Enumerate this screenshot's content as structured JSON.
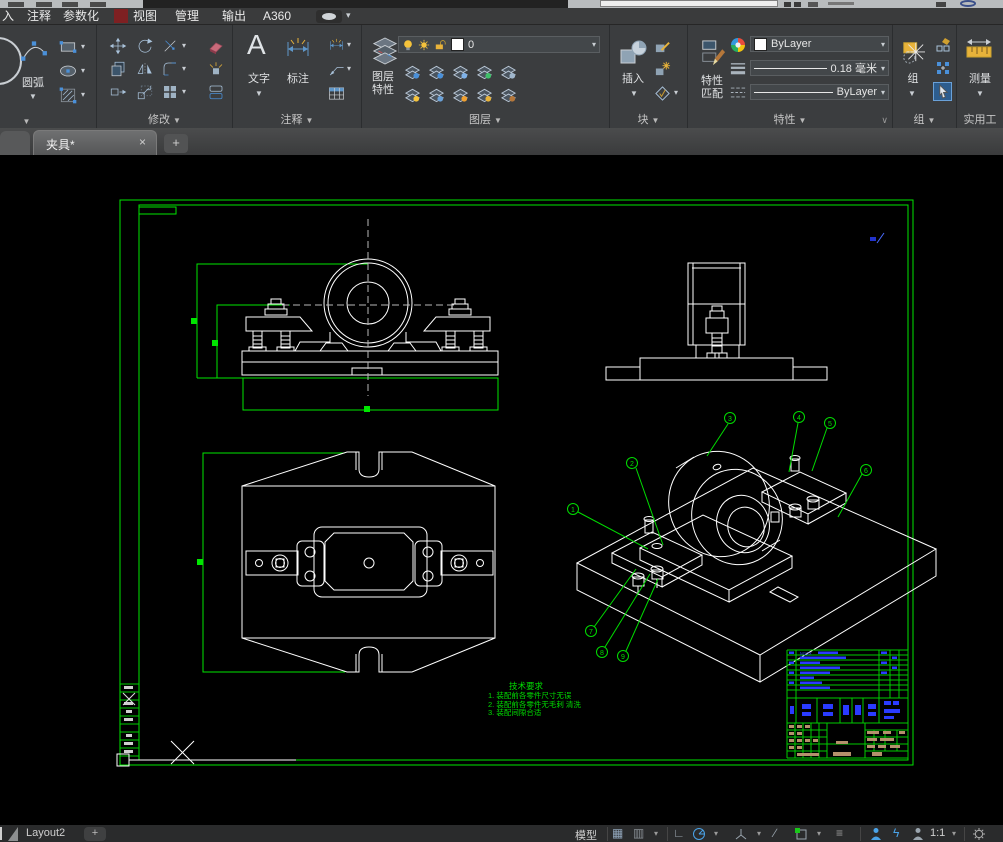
{
  "menu": {
    "tabs": [
      "入",
      "注释",
      "参数化",
      "视图",
      "管理",
      "输出",
      "A360"
    ]
  },
  "ribbon": {
    "arc": {
      "label": "圆弧"
    },
    "modify": {
      "label": "修改"
    },
    "annotate": {
      "label": "注释",
      "text_btn": "文字",
      "text_icon": "A",
      "dim_btn": "标注"
    },
    "layers": {
      "label": "图层",
      "props_btn": "图层特性",
      "current_layer": "0"
    },
    "block": {
      "label": "块",
      "insert_btn": "插入"
    },
    "properties": {
      "label": "特性",
      "match_btn": "特性匹配",
      "color": "ByLayer",
      "lineweight": "0.18 毫米",
      "linetype": "ByLayer"
    },
    "group": {
      "label": "组",
      "group_btn": "组"
    },
    "utilities": {
      "label": "实用工",
      "measure_btn": "测量"
    }
  },
  "file_tabs": {
    "active": "夹具*",
    "close": "×",
    "add": "+"
  },
  "canvas": {
    "tech_requirements": {
      "title": "技术要求",
      "line1": "1. 装配前各零件尺寸无误",
      "line2": "2. 装配前各零件无毛刺 清洗",
      "line3": "3. 装配间隙合适"
    },
    "balloons": [
      "1",
      "2",
      "3",
      "4",
      "5",
      "6",
      "7",
      "8",
      "9"
    ],
    "title_block_text": "M12X"
  },
  "status": {
    "layout_tab": "Layout2",
    "add_tab": "+",
    "model": "模型",
    "scale": "1:1"
  },
  "colors": {
    "layout_green": "#00e600",
    "drawing_white": "#ffffff",
    "bom_blue": "#2a3bff",
    "title_tan": "#b5916b",
    "ribbon_bg": "#3b3d3f",
    "canvas_bg": "#000000"
  }
}
